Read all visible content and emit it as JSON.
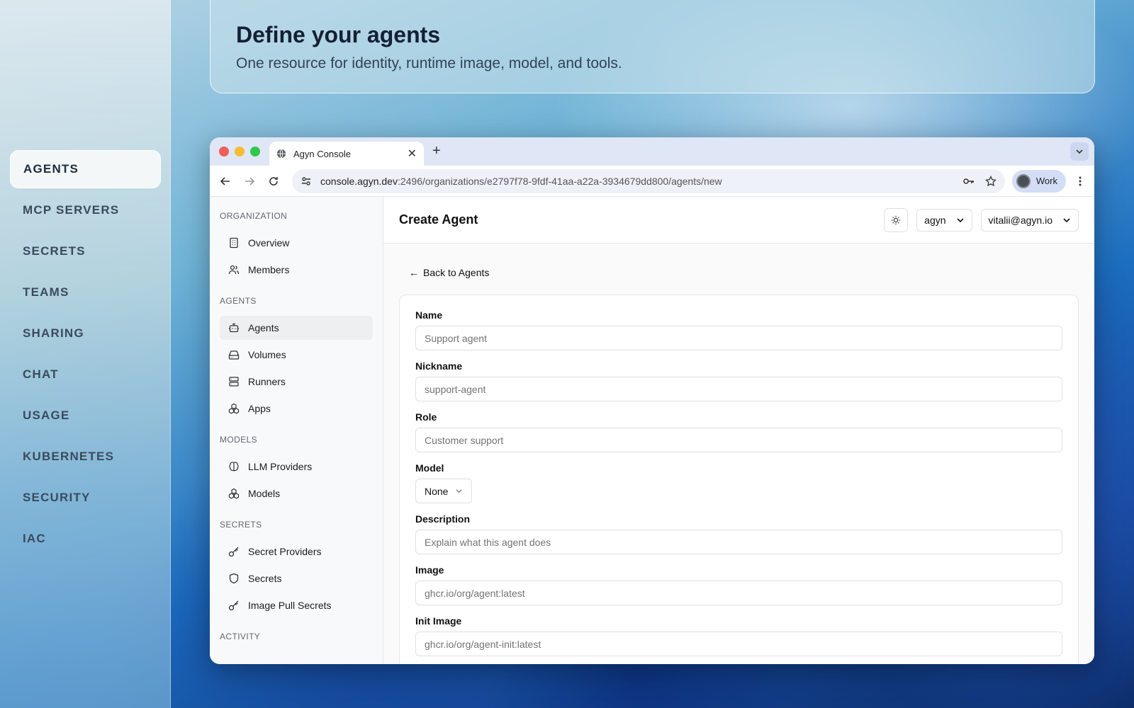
{
  "feature_nav": {
    "items": [
      {
        "label": "AGENTS",
        "active": true
      },
      {
        "label": "MCP SERVERS"
      },
      {
        "label": "SECRETS"
      },
      {
        "label": "TEAMS"
      },
      {
        "label": "SHARING"
      },
      {
        "label": "CHAT"
      },
      {
        "label": "USAGE"
      },
      {
        "label": "KUBERNETES"
      },
      {
        "label": "SECURITY"
      },
      {
        "label": "IAC"
      }
    ]
  },
  "hero": {
    "title": "Define your agents",
    "subtitle": "One resource for identity, runtime image, model, and tools."
  },
  "browser": {
    "tab_title": "Agyn Console",
    "url_host": "console.agyn.dev",
    "url_path": ":2496/organizations/e2797f78-9fdf-41aa-a22a-3934679dd800/agents/new",
    "profile_label": "Work"
  },
  "sidebar": {
    "sections": [
      {
        "title": "ORGANIZATION",
        "items": [
          {
            "label": "Overview",
            "icon": "building-icon"
          },
          {
            "label": "Members",
            "icon": "users-icon"
          }
        ]
      },
      {
        "title": "AGENTS",
        "items": [
          {
            "label": "Agents",
            "icon": "bot-icon",
            "active": true
          },
          {
            "label": "Volumes",
            "icon": "hard-drive-icon"
          },
          {
            "label": "Runners",
            "icon": "server-icon"
          },
          {
            "label": "Apps",
            "icon": "boxes-icon"
          }
        ]
      },
      {
        "title": "MODELS",
        "items": [
          {
            "label": "LLM Providers",
            "icon": "brain-icon"
          },
          {
            "label": "Models",
            "icon": "boxes-icon"
          }
        ]
      },
      {
        "title": "SECRETS",
        "items": [
          {
            "label": "Secret Providers",
            "icon": "key-icon"
          },
          {
            "label": "Secrets",
            "icon": "shield-icon"
          },
          {
            "label": "Image Pull Secrets",
            "icon": "key-icon"
          }
        ]
      },
      {
        "title": "ACTIVITY",
        "items": []
      }
    ]
  },
  "topbar": {
    "title": "Create Agent",
    "org_select": "agyn",
    "user_select": "vitalii@agyn.io"
  },
  "form": {
    "back_label": "Back to Agents",
    "name": {
      "label": "Name",
      "placeholder": "Support agent",
      "value": ""
    },
    "nickname": {
      "label": "Nickname",
      "placeholder": "support-agent",
      "value": ""
    },
    "role": {
      "label": "Role",
      "placeholder": "Customer support",
      "value": ""
    },
    "model": {
      "label": "Model",
      "selected": "None"
    },
    "description": {
      "label": "Description",
      "placeholder": "Explain what this agent does",
      "value": ""
    },
    "image": {
      "label": "Image",
      "placeholder": "ghcr.io/org/agent:latest",
      "value": ""
    },
    "init_image": {
      "label": "Init Image",
      "placeholder": "ghcr.io/org/agent-init:latest",
      "value": ""
    }
  },
  "colors": {
    "traffic_red": "#ee5f57",
    "traffic_yellow": "#f5bd2f",
    "traffic_green": "#2fc84c",
    "tabbar": "#dfe6f5"
  }
}
